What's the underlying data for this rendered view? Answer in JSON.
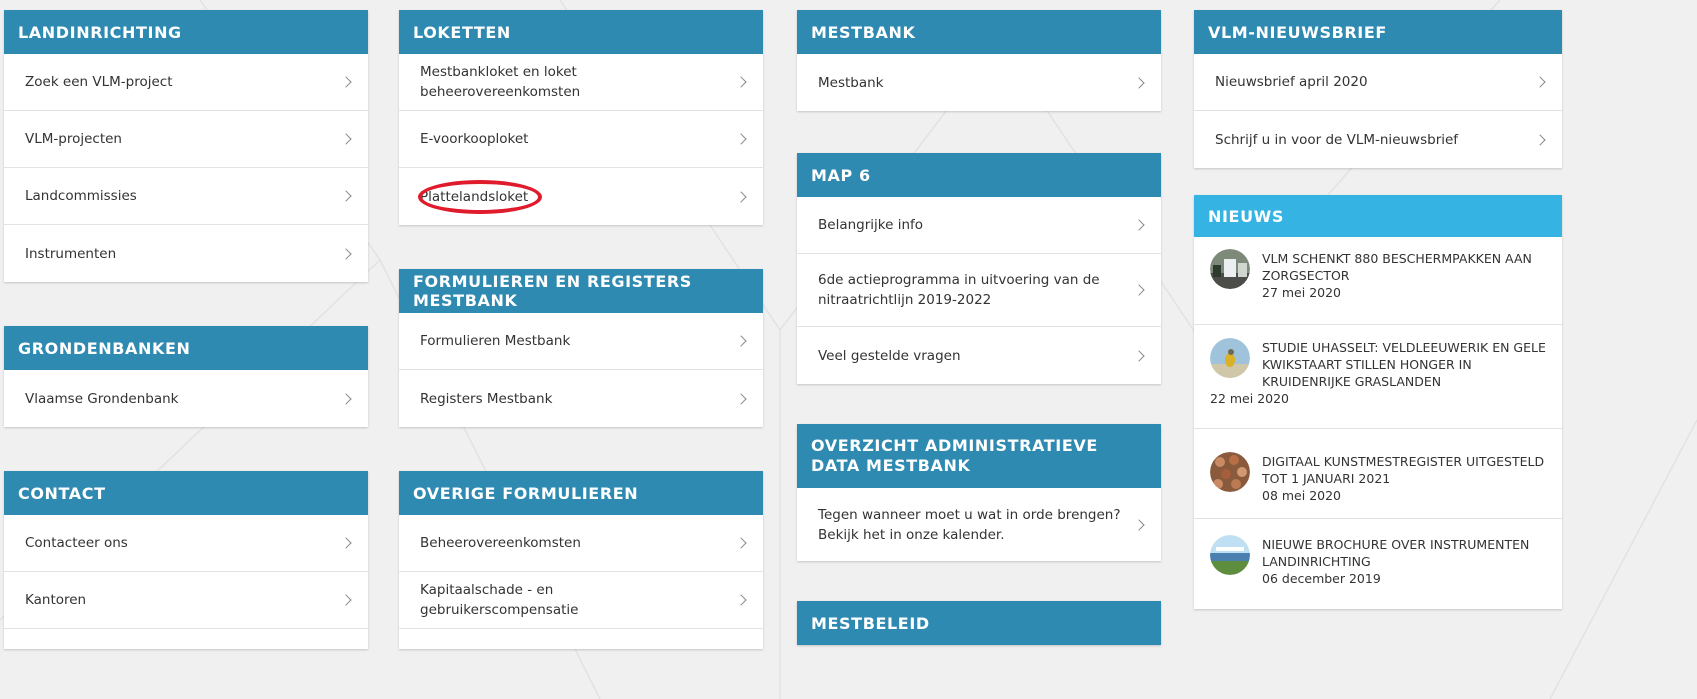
{
  "colors": {
    "header": "#2e8ab0",
    "header_light": "#35b4e4",
    "annotation": "#e01b2b",
    "background": "#f0f0f0"
  },
  "col1": {
    "landinrichting": {
      "title": "LANDINRICHTING",
      "items": [
        "Zoek een VLM-project",
        "VLM-projecten",
        "Landcommissies",
        "Instrumenten"
      ]
    },
    "grondenbanken": {
      "title": "GRONDENBANKEN",
      "items": [
        "Vlaamse Grondenbank"
      ]
    },
    "contact": {
      "title": "CONTACT",
      "items": [
        "Contacteer ons",
        "Kantoren"
      ]
    }
  },
  "col2": {
    "loketten": {
      "title": "LOKETTEN",
      "items": [
        "Mestbankloket en loket beheerovereenkomsten",
        "E-voorkooploket",
        "Plattelandsloket"
      ]
    },
    "formulieren": {
      "title": "FORMULIEREN EN REGISTERS MESTBANK",
      "items": [
        "Formulieren Mestbank",
        "Registers Mestbank"
      ]
    },
    "overige": {
      "title": "OVERIGE FORMULIEREN",
      "items": [
        "Beheerovereenkomsten",
        "Kapitaalschade - en gebruikerscompensatie"
      ]
    }
  },
  "col3": {
    "mestbank": {
      "title": "MESTBANK",
      "items": [
        "Mestbank"
      ]
    },
    "map6": {
      "title": "MAP 6",
      "items": [
        "Belangrijke info",
        "6de actieprogramma in uitvoering van de nitraatrichtlijn 2019-2022",
        "Veel gestelde vragen"
      ]
    },
    "overzicht": {
      "title": "OVERZICHT ADMINISTRATIEVE DATA MESTBANK",
      "items": [
        "Tegen wanneer moet u wat in orde brengen? Bekijk het in onze kalender."
      ]
    },
    "mestbeleid": {
      "title": "MESTBELEID"
    }
  },
  "col4": {
    "nieuwsbrief": {
      "title": "VLM-NIEUWSBRIEF",
      "items": [
        "Nieuwsbrief april 2020",
        "Schrijf u in voor de VLM-nieuwsbrief"
      ]
    },
    "nieuws": {
      "title": "NIEUWS",
      "items": [
        {
          "title": "VLM schenkt 880 beschermpakken aan zorgsector",
          "date": "27 mei 2020",
          "icon": "news-thumbnail-protective-suits"
        },
        {
          "title": "Studie UHasselt: veldleeuwerik en gele kwikstaart stillen honger in kruidenrijke graslanden",
          "date": "22 mei 2020",
          "icon": "news-thumbnail-bird"
        },
        {
          "title": "Digitaal kunstmestregister uitgesteld tot 1 januari 2021",
          "date": "08 mei 2020",
          "icon": "news-thumbnail-fertilizer"
        },
        {
          "title": "Nieuwe brochure over instrumenten landinrichting",
          "date": "06 december 2019",
          "icon": "news-thumbnail-landscape"
        }
      ]
    }
  }
}
